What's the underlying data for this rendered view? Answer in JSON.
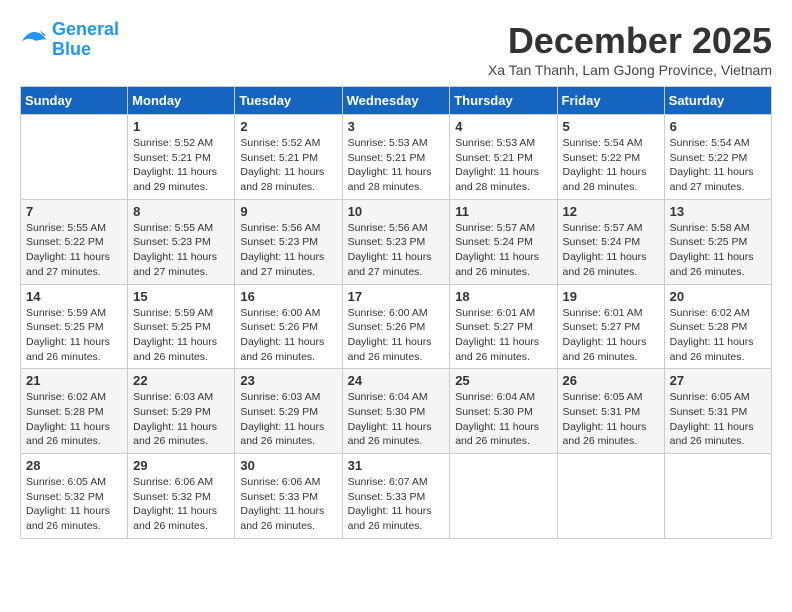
{
  "logo": {
    "line1": "General",
    "line2": "Blue"
  },
  "title": "December 2025",
  "subtitle": "Xa Tan Thanh, Lam GJong Province, Vietnam",
  "days_header": [
    "Sunday",
    "Monday",
    "Tuesday",
    "Wednesday",
    "Thursday",
    "Friday",
    "Saturday"
  ],
  "weeks": [
    [
      {
        "day": "",
        "info": ""
      },
      {
        "day": "1",
        "info": "Sunrise: 5:52 AM\nSunset: 5:21 PM\nDaylight: 11 hours\nand 29 minutes."
      },
      {
        "day": "2",
        "info": "Sunrise: 5:52 AM\nSunset: 5:21 PM\nDaylight: 11 hours\nand 28 minutes."
      },
      {
        "day": "3",
        "info": "Sunrise: 5:53 AM\nSunset: 5:21 PM\nDaylight: 11 hours\nand 28 minutes."
      },
      {
        "day": "4",
        "info": "Sunrise: 5:53 AM\nSunset: 5:21 PM\nDaylight: 11 hours\nand 28 minutes."
      },
      {
        "day": "5",
        "info": "Sunrise: 5:54 AM\nSunset: 5:22 PM\nDaylight: 11 hours\nand 28 minutes."
      },
      {
        "day": "6",
        "info": "Sunrise: 5:54 AM\nSunset: 5:22 PM\nDaylight: 11 hours\nand 27 minutes."
      }
    ],
    [
      {
        "day": "7",
        "info": "Sunrise: 5:55 AM\nSunset: 5:22 PM\nDaylight: 11 hours\nand 27 minutes."
      },
      {
        "day": "8",
        "info": "Sunrise: 5:55 AM\nSunset: 5:23 PM\nDaylight: 11 hours\nand 27 minutes."
      },
      {
        "day": "9",
        "info": "Sunrise: 5:56 AM\nSunset: 5:23 PM\nDaylight: 11 hours\nand 27 minutes."
      },
      {
        "day": "10",
        "info": "Sunrise: 5:56 AM\nSunset: 5:23 PM\nDaylight: 11 hours\nand 27 minutes."
      },
      {
        "day": "11",
        "info": "Sunrise: 5:57 AM\nSunset: 5:24 PM\nDaylight: 11 hours\nand 26 minutes."
      },
      {
        "day": "12",
        "info": "Sunrise: 5:57 AM\nSunset: 5:24 PM\nDaylight: 11 hours\nand 26 minutes."
      },
      {
        "day": "13",
        "info": "Sunrise: 5:58 AM\nSunset: 5:25 PM\nDaylight: 11 hours\nand 26 minutes."
      }
    ],
    [
      {
        "day": "14",
        "info": "Sunrise: 5:59 AM\nSunset: 5:25 PM\nDaylight: 11 hours\nand 26 minutes."
      },
      {
        "day": "15",
        "info": "Sunrise: 5:59 AM\nSunset: 5:25 PM\nDaylight: 11 hours\nand 26 minutes."
      },
      {
        "day": "16",
        "info": "Sunrise: 6:00 AM\nSunset: 5:26 PM\nDaylight: 11 hours\nand 26 minutes."
      },
      {
        "day": "17",
        "info": "Sunrise: 6:00 AM\nSunset: 5:26 PM\nDaylight: 11 hours\nand 26 minutes."
      },
      {
        "day": "18",
        "info": "Sunrise: 6:01 AM\nSunset: 5:27 PM\nDaylight: 11 hours\nand 26 minutes."
      },
      {
        "day": "19",
        "info": "Sunrise: 6:01 AM\nSunset: 5:27 PM\nDaylight: 11 hours\nand 26 minutes."
      },
      {
        "day": "20",
        "info": "Sunrise: 6:02 AM\nSunset: 5:28 PM\nDaylight: 11 hours\nand 26 minutes."
      }
    ],
    [
      {
        "day": "21",
        "info": "Sunrise: 6:02 AM\nSunset: 5:28 PM\nDaylight: 11 hours\nand 26 minutes."
      },
      {
        "day": "22",
        "info": "Sunrise: 6:03 AM\nSunset: 5:29 PM\nDaylight: 11 hours\nand 26 minutes."
      },
      {
        "day": "23",
        "info": "Sunrise: 6:03 AM\nSunset: 5:29 PM\nDaylight: 11 hours\nand 26 minutes."
      },
      {
        "day": "24",
        "info": "Sunrise: 6:04 AM\nSunset: 5:30 PM\nDaylight: 11 hours\nand 26 minutes."
      },
      {
        "day": "25",
        "info": "Sunrise: 6:04 AM\nSunset: 5:30 PM\nDaylight: 11 hours\nand 26 minutes."
      },
      {
        "day": "26",
        "info": "Sunrise: 6:05 AM\nSunset: 5:31 PM\nDaylight: 11 hours\nand 26 minutes."
      },
      {
        "day": "27",
        "info": "Sunrise: 6:05 AM\nSunset: 5:31 PM\nDaylight: 11 hours\nand 26 minutes."
      }
    ],
    [
      {
        "day": "28",
        "info": "Sunrise: 6:05 AM\nSunset: 5:32 PM\nDaylight: 11 hours\nand 26 minutes."
      },
      {
        "day": "29",
        "info": "Sunrise: 6:06 AM\nSunset: 5:32 PM\nDaylight: 11 hours\nand 26 minutes."
      },
      {
        "day": "30",
        "info": "Sunrise: 6:06 AM\nSunset: 5:33 PM\nDaylight: 11 hours\nand 26 minutes."
      },
      {
        "day": "31",
        "info": "Sunrise: 6:07 AM\nSunset: 5:33 PM\nDaylight: 11 hours\nand 26 minutes."
      },
      {
        "day": "",
        "info": ""
      },
      {
        "day": "",
        "info": ""
      },
      {
        "day": "",
        "info": ""
      }
    ]
  ]
}
